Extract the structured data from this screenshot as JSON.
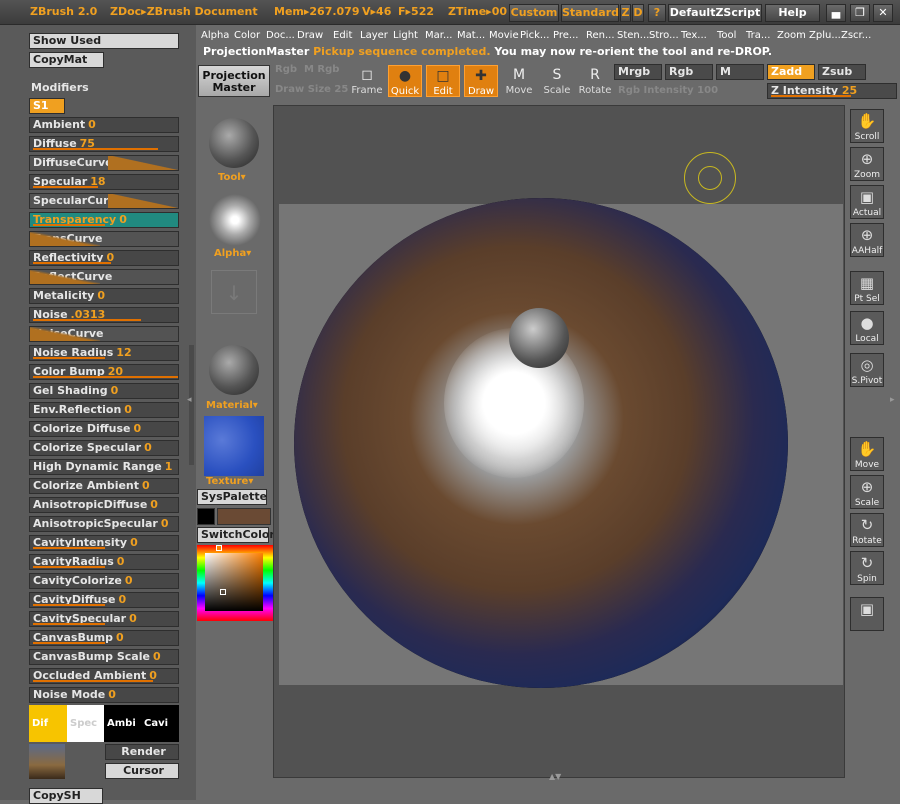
{
  "titlebar": {
    "app": "ZBrush 2.0",
    "doc": "ZDoc▸ZBrush Document",
    "mem": "Mem▸267.079",
    "v": "V▸46",
    "f": "F▸522",
    "ztime": "ZTime▸00",
    "custom": "Custom",
    "standard": "Standard",
    "z": "Z",
    "d": "D",
    "q": "?",
    "script": "DefaultZScript",
    "help": "Help"
  },
  "menus": [
    "Alpha",
    "Color",
    "Doc...",
    "Draw",
    "Edit",
    "Layer",
    "Light",
    "Mar...",
    "Mat...",
    "Movie",
    "Pick...",
    "Pre...",
    "Ren...",
    "Sten...",
    "Stro...",
    "Tex...",
    "Tool",
    "Tra...",
    "Zoom",
    "Zplu...",
    "Zscr..."
  ],
  "status": {
    "prefix": "ProjectionMaster",
    "highlight": "Pickup sequence completed.",
    "rest": "You may now re-orient the tool and re-DROP."
  },
  "left": {
    "show_used": "Show Used",
    "copymat": "CopyMat",
    "modifiers": "Modifiers",
    "s1": "S1",
    "swatches": [
      {
        "label": "Dif",
        "color": "#f7c400"
      },
      {
        "label": "Spec",
        "color": "#ffffff"
      },
      {
        "label": "Ambi",
        "color": "#000000"
      },
      {
        "label": "Cavi",
        "color": "#000000"
      }
    ],
    "render": "Render",
    "cursor": "Cursor",
    "copysh": "CopySH",
    "items": [
      {
        "label": "Ambient",
        "value": "0"
      },
      {
        "label": "Diffuse",
        "value": "75"
      },
      {
        "label": "DiffuseCurve",
        "value": ""
      },
      {
        "label": "Specular",
        "value": "18"
      },
      {
        "label": "SpecularCurve",
        "value": ""
      },
      {
        "label": "Transparency",
        "value": "0"
      },
      {
        "label": "TransCurve",
        "value": ""
      },
      {
        "label": "Reflectivity",
        "value": "0"
      },
      {
        "label": "ReflectCurve",
        "value": ""
      },
      {
        "label": "Metalicity",
        "value": "0"
      },
      {
        "label": "Noise",
        "value": ".0313"
      },
      {
        "label": "NoiseCurve",
        "value": ""
      },
      {
        "label": "Noise Radius",
        "value": "12"
      },
      {
        "label": "Color Bump",
        "value": "20"
      },
      {
        "label": "Gel Shading",
        "value": "0"
      },
      {
        "label": "Env.Reflection",
        "value": "0"
      },
      {
        "label": "Colorize Diffuse",
        "value": "0"
      },
      {
        "label": "Colorize Specular",
        "value": "0"
      },
      {
        "label": "High Dynamic Range",
        "value": "1"
      },
      {
        "label": "Colorize Ambient",
        "value": "0"
      },
      {
        "label": "AnisotropicDiffuse",
        "value": "0"
      },
      {
        "label": "AnisotropicSpecular",
        "value": "0"
      },
      {
        "label": "CavityIntensity",
        "value": "0"
      },
      {
        "label": "CavityRadius",
        "value": "0"
      },
      {
        "label": "CavityColorize",
        "value": "0"
      },
      {
        "label": "CavityDiffuse",
        "value": "0"
      },
      {
        "label": "CavitySpecular",
        "value": "0"
      },
      {
        "label": "CanvasBump",
        "value": "0"
      },
      {
        "label": "CanvasBump Scale",
        "value": "0"
      },
      {
        "label": "Occluded Ambient",
        "value": "0"
      },
      {
        "label": "Noise Mode",
        "value": "0"
      }
    ]
  },
  "toolcol": {
    "tool": "Tool▾",
    "alpha": "Alpha▾",
    "material": "Material▾",
    "texture": "Texture▾",
    "syspalette": "SysPalette",
    "switchcolor": "SwitchColor"
  },
  "toolbar": {
    "projection": "Projection Master",
    "frame": "Frame",
    "quick": "Quick",
    "edit": "Edit",
    "draw": "Draw",
    "move": "Move",
    "scale": "Scale",
    "rotate": "Rotate",
    "mrgb": "Mrgb",
    "rgb": "Rgb",
    "m": "M",
    "zadd": "Zadd",
    "zsub": "Zsub",
    "zint_label": "Z Intensity",
    "zint_value": "25",
    "rgb_int": "Rgb Intensity 100",
    "draw_size": "Draw Size 25"
  },
  "right": [
    {
      "label": "Scroll",
      "icon": "✋"
    },
    {
      "label": "Zoom",
      "icon": "⊕"
    },
    {
      "label": "Actual",
      "icon": "▣"
    },
    {
      "label": "AAHalf",
      "icon": "⊕"
    },
    {
      "label": "Pt Sel",
      "icon": "▦"
    },
    {
      "label": "Local",
      "icon": "●"
    },
    {
      "label": "S.Pivot",
      "icon": "◎"
    },
    {
      "label": "Move",
      "icon": "✋"
    },
    {
      "label": "Scale",
      "icon": "⊕"
    },
    {
      "label": "Rotate",
      "icon": "↻"
    },
    {
      "label": "Spin",
      "icon": "↻"
    },
    {
      "label": "",
      "icon": "▣"
    }
  ]
}
